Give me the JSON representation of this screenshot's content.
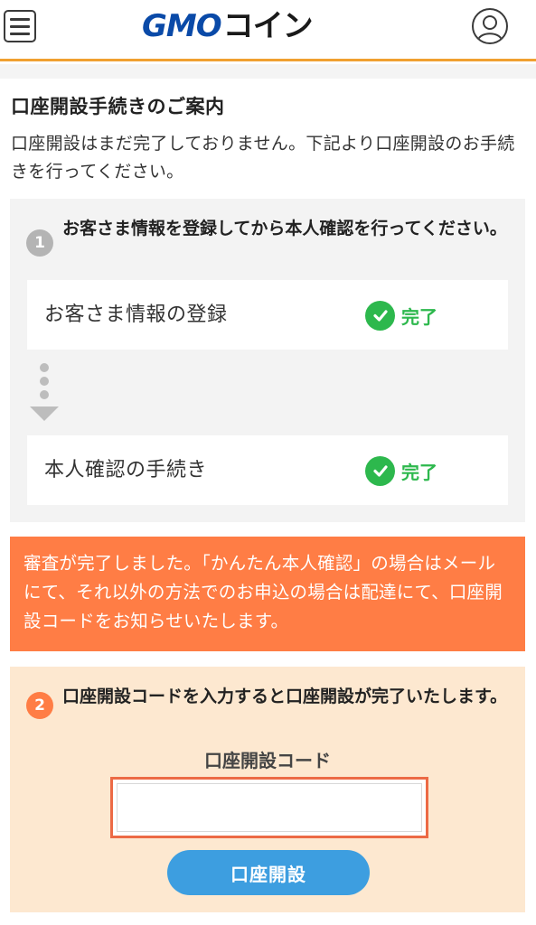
{
  "header": {
    "logo_gmo": "GMO",
    "logo_coin": "コイン",
    "menu_icon": "hamburger-menu-icon",
    "account_icon": "user-account-icon",
    "accent_color": "#f0a030"
  },
  "intro": {
    "title": "口座開設手続きのご案内",
    "text": "口座開設はまだ完了しておりません。下記より口座開設のお手続きを行ってください。"
  },
  "step1": {
    "number": "1",
    "heading": "お客さま情報を登録してから本人確認を行ってください。",
    "items": [
      {
        "label": "お客さま情報の登録",
        "status": "完了",
        "status_icon": "check-circle-icon"
      },
      {
        "label": "本人確認の手続き",
        "status": "完了",
        "status_icon": "check-circle-icon"
      }
    ],
    "status_color": "#2db84d"
  },
  "notice": {
    "text": "審査が完了しました。「かんたん本人確認」の場合はメールにて、それ以外の方法でのお申込の場合は配達にて、口座開設コードをお知らせいたします。",
    "color": "#ff7d45"
  },
  "step2": {
    "number": "2",
    "heading": "口座開設コードを入力すると口座開設が完了いたします。",
    "code_label": "口座開設コード",
    "code_value": "",
    "submit_label": "口座開設",
    "button_color": "#3d9ee0"
  }
}
